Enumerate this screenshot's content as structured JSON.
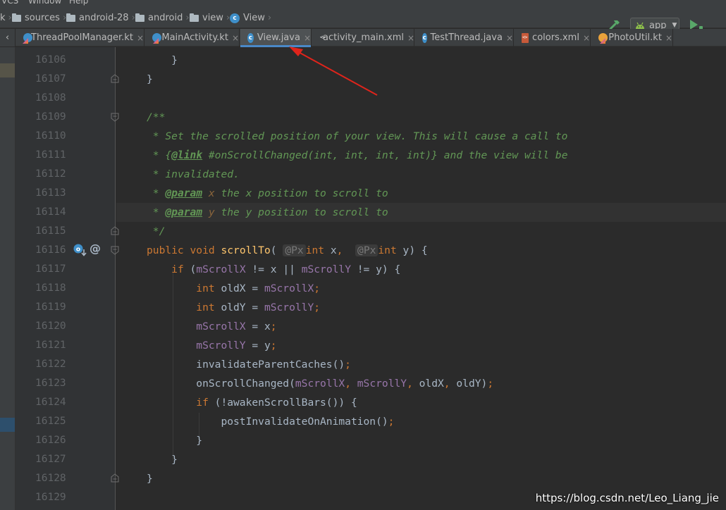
{
  "menubar": {
    "items": [
      "VCS",
      "Window",
      "Help"
    ]
  },
  "breadcrumb": {
    "items": [
      {
        "label": "sources",
        "icon": "folder-icon"
      },
      {
        "label": "android-28",
        "icon": "folder-icon"
      },
      {
        "label": "android",
        "icon": "folder-icon"
      },
      {
        "label": "view",
        "icon": "folder-icon"
      },
      {
        "label": "View",
        "icon": "class-icon",
        "icon_glyph": "c"
      }
    ],
    "first_fragment": "k"
  },
  "toolbar": {
    "run_config": "app"
  },
  "tabs": [
    {
      "label": "ThreadPoolManager.kt",
      "icon": "kotlin-class-icon",
      "active": false
    },
    {
      "label": "MainActivity.kt",
      "icon": "kotlin-class-icon",
      "active": false
    },
    {
      "label": "View.java",
      "icon": "java-class-icon",
      "icon_glyph": "c",
      "active": true
    },
    {
      "label": "activity_main.xml",
      "icon": "xml-file-icon",
      "active": false
    },
    {
      "label": "TestThread.java",
      "icon": "java-class-icon",
      "icon_glyph": "c",
      "active": false
    },
    {
      "label": "colors.xml",
      "icon": "xml-file-icon",
      "active": false
    },
    {
      "label": "PhotoUtil.kt",
      "icon": "kotlin-file-icon",
      "active": false
    }
  ],
  "tab_close_glyph": "×",
  "tab_stub_glyph": "‹",
  "line_numbers": [
    "16106",
    "16107",
    "16108",
    "16109",
    "16110",
    "16111",
    "16112",
    "16113",
    "16114",
    "16115",
    "16116",
    "16117",
    "16118",
    "16119",
    "16120",
    "16121",
    "16122",
    "16123",
    "16124",
    "16125",
    "16126",
    "16127",
    "16128",
    "16129"
  ],
  "current_line": "16114",
  "code": {
    "l16106": "}",
    "l16107": "}",
    "l16109": "/**",
    "l16110": "* Set the scrolled position of your view. This will cause a call to",
    "l16111_pre": "* {",
    "l16111_tag": "@link",
    "l16111_post": " #onScrollChanged(int, int, int, int)} and the view will be",
    "l16112": "* invalidated.",
    "l16113_pre": "* ",
    "l16113_tag": "@param",
    "l16113_name": " x",
    "l16113_post": " the x position to scroll to",
    "l16114_pre": "* ",
    "l16114_tag": "@param",
    "l16114_name": " y",
    "l16114_post": " the y position to scroll to",
    "l16115": "*/",
    "l16116": {
      "kw1": "public",
      "kw2": "void",
      "fn": "scrollTo",
      "hint1": "@Px",
      "t1": "int",
      "p1": "x",
      "hint2": "@Px",
      "t2": "int",
      "p2": "y"
    },
    "l16117": {
      "kw": "if",
      "f1": "mScrollX",
      "op1": " != x || ",
      "f2": "mScrollY",
      "op2": " != y) {"
    },
    "l16118": {
      "kw": "int",
      "v": " oldX = ",
      "f": "mScrollX"
    },
    "l16119": {
      "kw": "int",
      "v": " oldY = ",
      "f": "mScrollY"
    },
    "l16120": {
      "f": "mScrollX",
      "v": " = x"
    },
    "l16121": {
      "f": "mScrollY",
      "v": " = y"
    },
    "l16122": "invalidateParentCaches()",
    "l16123": {
      "call": "onScrollChanged(",
      "f1": "mScrollX",
      "f2": "mScrollY",
      "rest": "oldX",
      "rest2": "oldY",
      "close": ")"
    },
    "l16124": {
      "kw": "if",
      "rest": " (!awakenScrollBars()) {"
    },
    "l16125": "postInvalidateOnAnimation()",
    "l16126": "}",
    "l16127": "}",
    "l16128": "}"
  },
  "watermark": "https://blog.csdn.net/Leo_Liang_jie",
  "colors": {
    "editor_bg": "#2b2b2b",
    "keyword": "#cc7832",
    "method": "#ffc66d",
    "field": "#9876aa",
    "doc_comment": "#629755",
    "annotation_arrow": "#e0241b"
  }
}
